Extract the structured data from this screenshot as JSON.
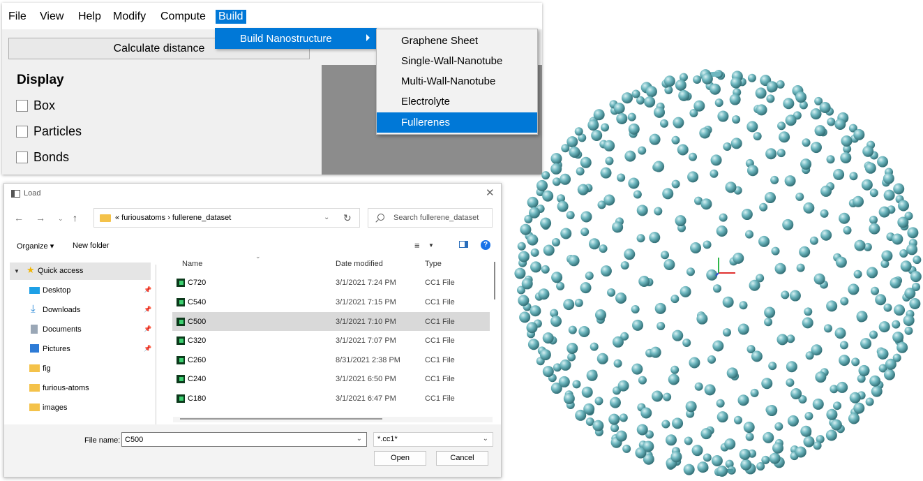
{
  "app": {
    "menu": [
      "File",
      "View",
      "Help",
      "Modify",
      "Compute",
      "Build"
    ],
    "active_menu": "Build",
    "calc_button": "Calculate distance",
    "display_title": "Display",
    "checkboxes": [
      {
        "label": "Box",
        "checked": false
      },
      {
        "label": "Particles",
        "checked": false
      },
      {
        "label": "Bonds",
        "checked": false
      }
    ],
    "submenu_label": "Build Nanostructure",
    "nano_items": [
      "Graphene Sheet",
      "Single-Wall-Nanotube",
      "Multi-Wall-Nanotube",
      "Electrolyte",
      "Fullerenes"
    ],
    "selected_item": "Fullerenes",
    "colors": {
      "accent": "#0078d7",
      "viewport": "#8c8c8c"
    }
  },
  "dialog": {
    "title": "Load",
    "close_icon": "close-icon",
    "path": "« furiousatoms  ›  fullerene_dataset",
    "search_placeholder": "Search fullerene_dataset",
    "organize": "Organize ▾",
    "new_folder": "New folder",
    "nav": [
      {
        "label": "Quick access",
        "icon": "star-icon",
        "pinned": false
      },
      {
        "label": "Desktop",
        "icon": "desktop-icon",
        "pinned": true
      },
      {
        "label": "Downloads",
        "icon": "download-icon",
        "pinned": true
      },
      {
        "label": "Documents",
        "icon": "document-icon",
        "pinned": true
      },
      {
        "label": "Pictures",
        "icon": "picture-icon",
        "pinned": true
      },
      {
        "label": "fig",
        "icon": "folder-icon",
        "pinned": false
      },
      {
        "label": "furious-atoms",
        "icon": "folder-icon",
        "pinned": false
      },
      {
        "label": "images",
        "icon": "folder-icon",
        "pinned": false
      }
    ],
    "columns": {
      "name": "Name",
      "date": "Date modified",
      "type": "Type"
    },
    "files": [
      {
        "name": "C720",
        "date": "3/1/2021 7:24 PM",
        "type": "CC1 File"
      },
      {
        "name": "C540",
        "date": "3/1/2021 7:15 PM",
        "type": "CC1 File"
      },
      {
        "name": "C500",
        "date": "3/1/2021 7:10 PM",
        "type": "CC1 File"
      },
      {
        "name": "C320",
        "date": "3/1/2021 7:07 PM",
        "type": "CC1 File"
      },
      {
        "name": "C260",
        "date": "8/31/2021 2:38 PM",
        "type": "CC1 File"
      },
      {
        "name": "C240",
        "date": "3/1/2021 6:50 PM",
        "type": "CC1 File"
      },
      {
        "name": "C180",
        "date": "3/1/2021 6:47 PM",
        "type": "CC1 File"
      }
    ],
    "selected_file": "C500",
    "file_name_label": "File name:",
    "file_name_value": "C500",
    "filter": "*.cc1*",
    "open": "Open",
    "cancel": "Cancel"
  },
  "molecule": {
    "atom_color": "#6fb8c0",
    "axes_colors": {
      "x": "#e0302f",
      "y": "#2fb84a",
      "z": "#2b4fd6"
    }
  }
}
